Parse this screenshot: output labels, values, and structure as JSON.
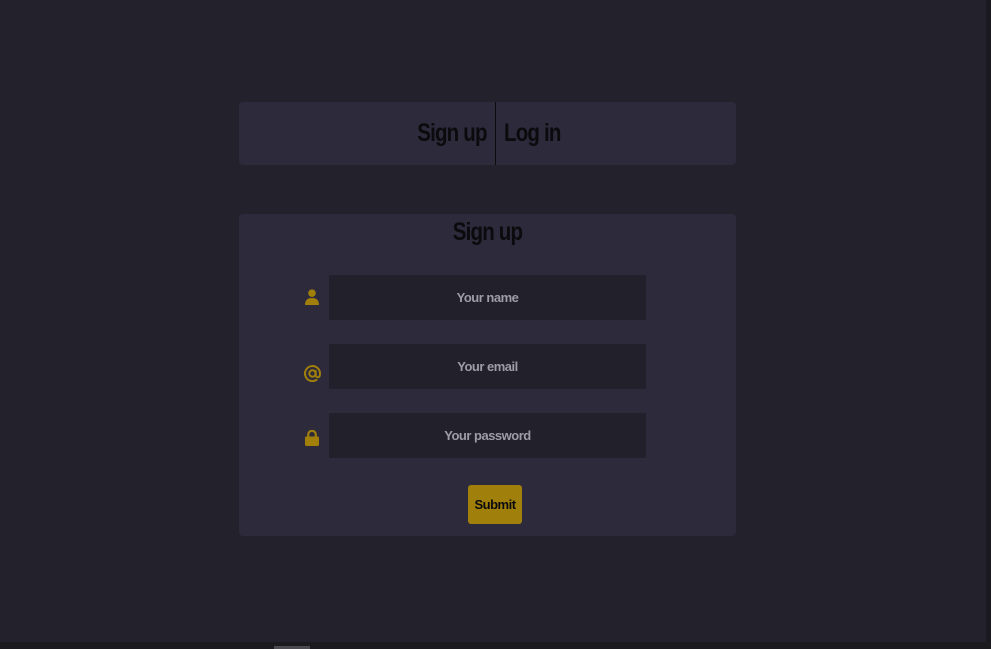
{
  "tabs": {
    "signup_label": "Sign up",
    "login_label": "Log in"
  },
  "form": {
    "title": "Sign up",
    "name_placeholder": "Your name",
    "email_placeholder": "Your email",
    "password_placeholder": "Your password",
    "submit_label": "Submit"
  },
  "icons": {
    "name": "user-icon",
    "email": "at-sign-icon",
    "password": "lock-icon"
  },
  "colors": {
    "background": "#23212b",
    "card": "#2d2a3b",
    "input": "#22202a",
    "accent": "#a07f0b",
    "text_dark": "#0b0b0e"
  }
}
